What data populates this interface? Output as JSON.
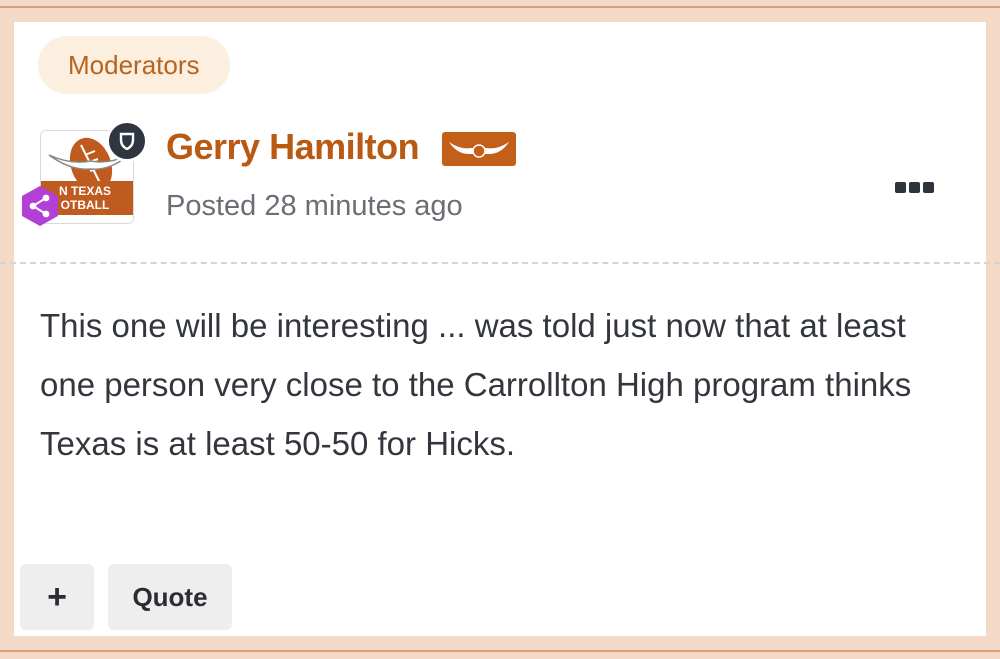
{
  "post": {
    "role_badge": "Moderators",
    "author": {
      "name": "Gerry Hamilton",
      "badge_icon": "og-longhorn-badge-icon",
      "role_icon": "shield-icon",
      "secondary_icon": "share-icon",
      "avatar_text_line1": "N TEXAS",
      "avatar_text_line2": "OTBALL"
    },
    "posted_time": "Posted 28 minutes ago",
    "body": "This one will be interesting ... was told just now that at least one person very close to the Carrollton High program thinks Texas is at least 50-50 for Hicks.",
    "actions": {
      "react_label": "+",
      "quote_label": "Quote"
    },
    "more_menu_icon": "more-horizontal-icon"
  },
  "colors": {
    "accent": "#b85a12",
    "badge_bg": "#fcefdf",
    "og_badge": "#c45f19",
    "frame": "#f4dac6",
    "share_badge": "#b23fd6"
  }
}
